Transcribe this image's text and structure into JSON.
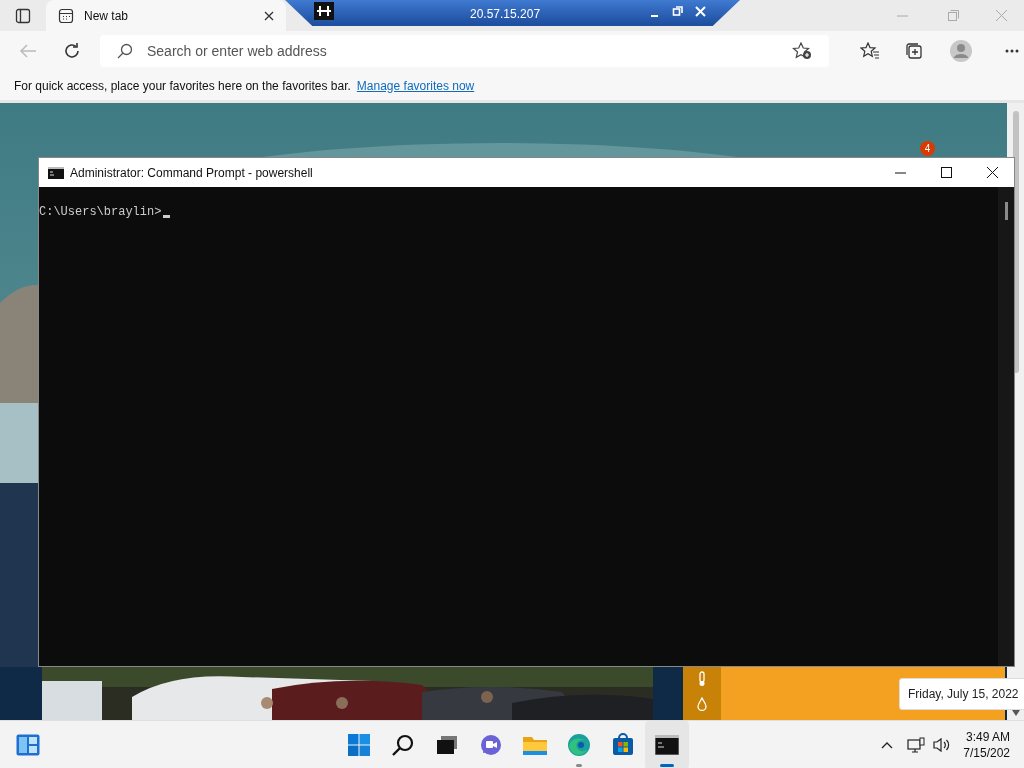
{
  "browser": {
    "tabs": [
      {
        "label": "New tab",
        "selected": true
      }
    ],
    "remote_bar": {
      "title": "20.57.15.207"
    },
    "address_bar": {
      "placeholder": "Search or enter web address"
    },
    "favorites_bar": {
      "message": "For quick access, place your favorites here on the favorites bar.",
      "link": "Manage favorites now"
    },
    "notification_badge": "4"
  },
  "console_window": {
    "title": "Administrator: Command Prompt - powershell",
    "lines": [
      "C:\\Users\\braylin>"
    ]
  },
  "tooltip": "Friday, July 15, 2022",
  "taskbar": {
    "apps": [
      {
        "kind": "start",
        "running": false,
        "selected": false
      },
      {
        "kind": "search",
        "running": false,
        "selected": false
      },
      {
        "kind": "taskview",
        "running": false,
        "selected": false
      },
      {
        "kind": "chat",
        "running": false,
        "selected": false
      },
      {
        "kind": "explorer",
        "running": false,
        "selected": false
      },
      {
        "kind": "edge",
        "running": true,
        "selected": false
      },
      {
        "kind": "store",
        "running": false,
        "selected": false
      },
      {
        "kind": "terminal",
        "running": true,
        "selected": true
      }
    ],
    "time": "3:49 AM",
    "date": "7/15/202"
  }
}
